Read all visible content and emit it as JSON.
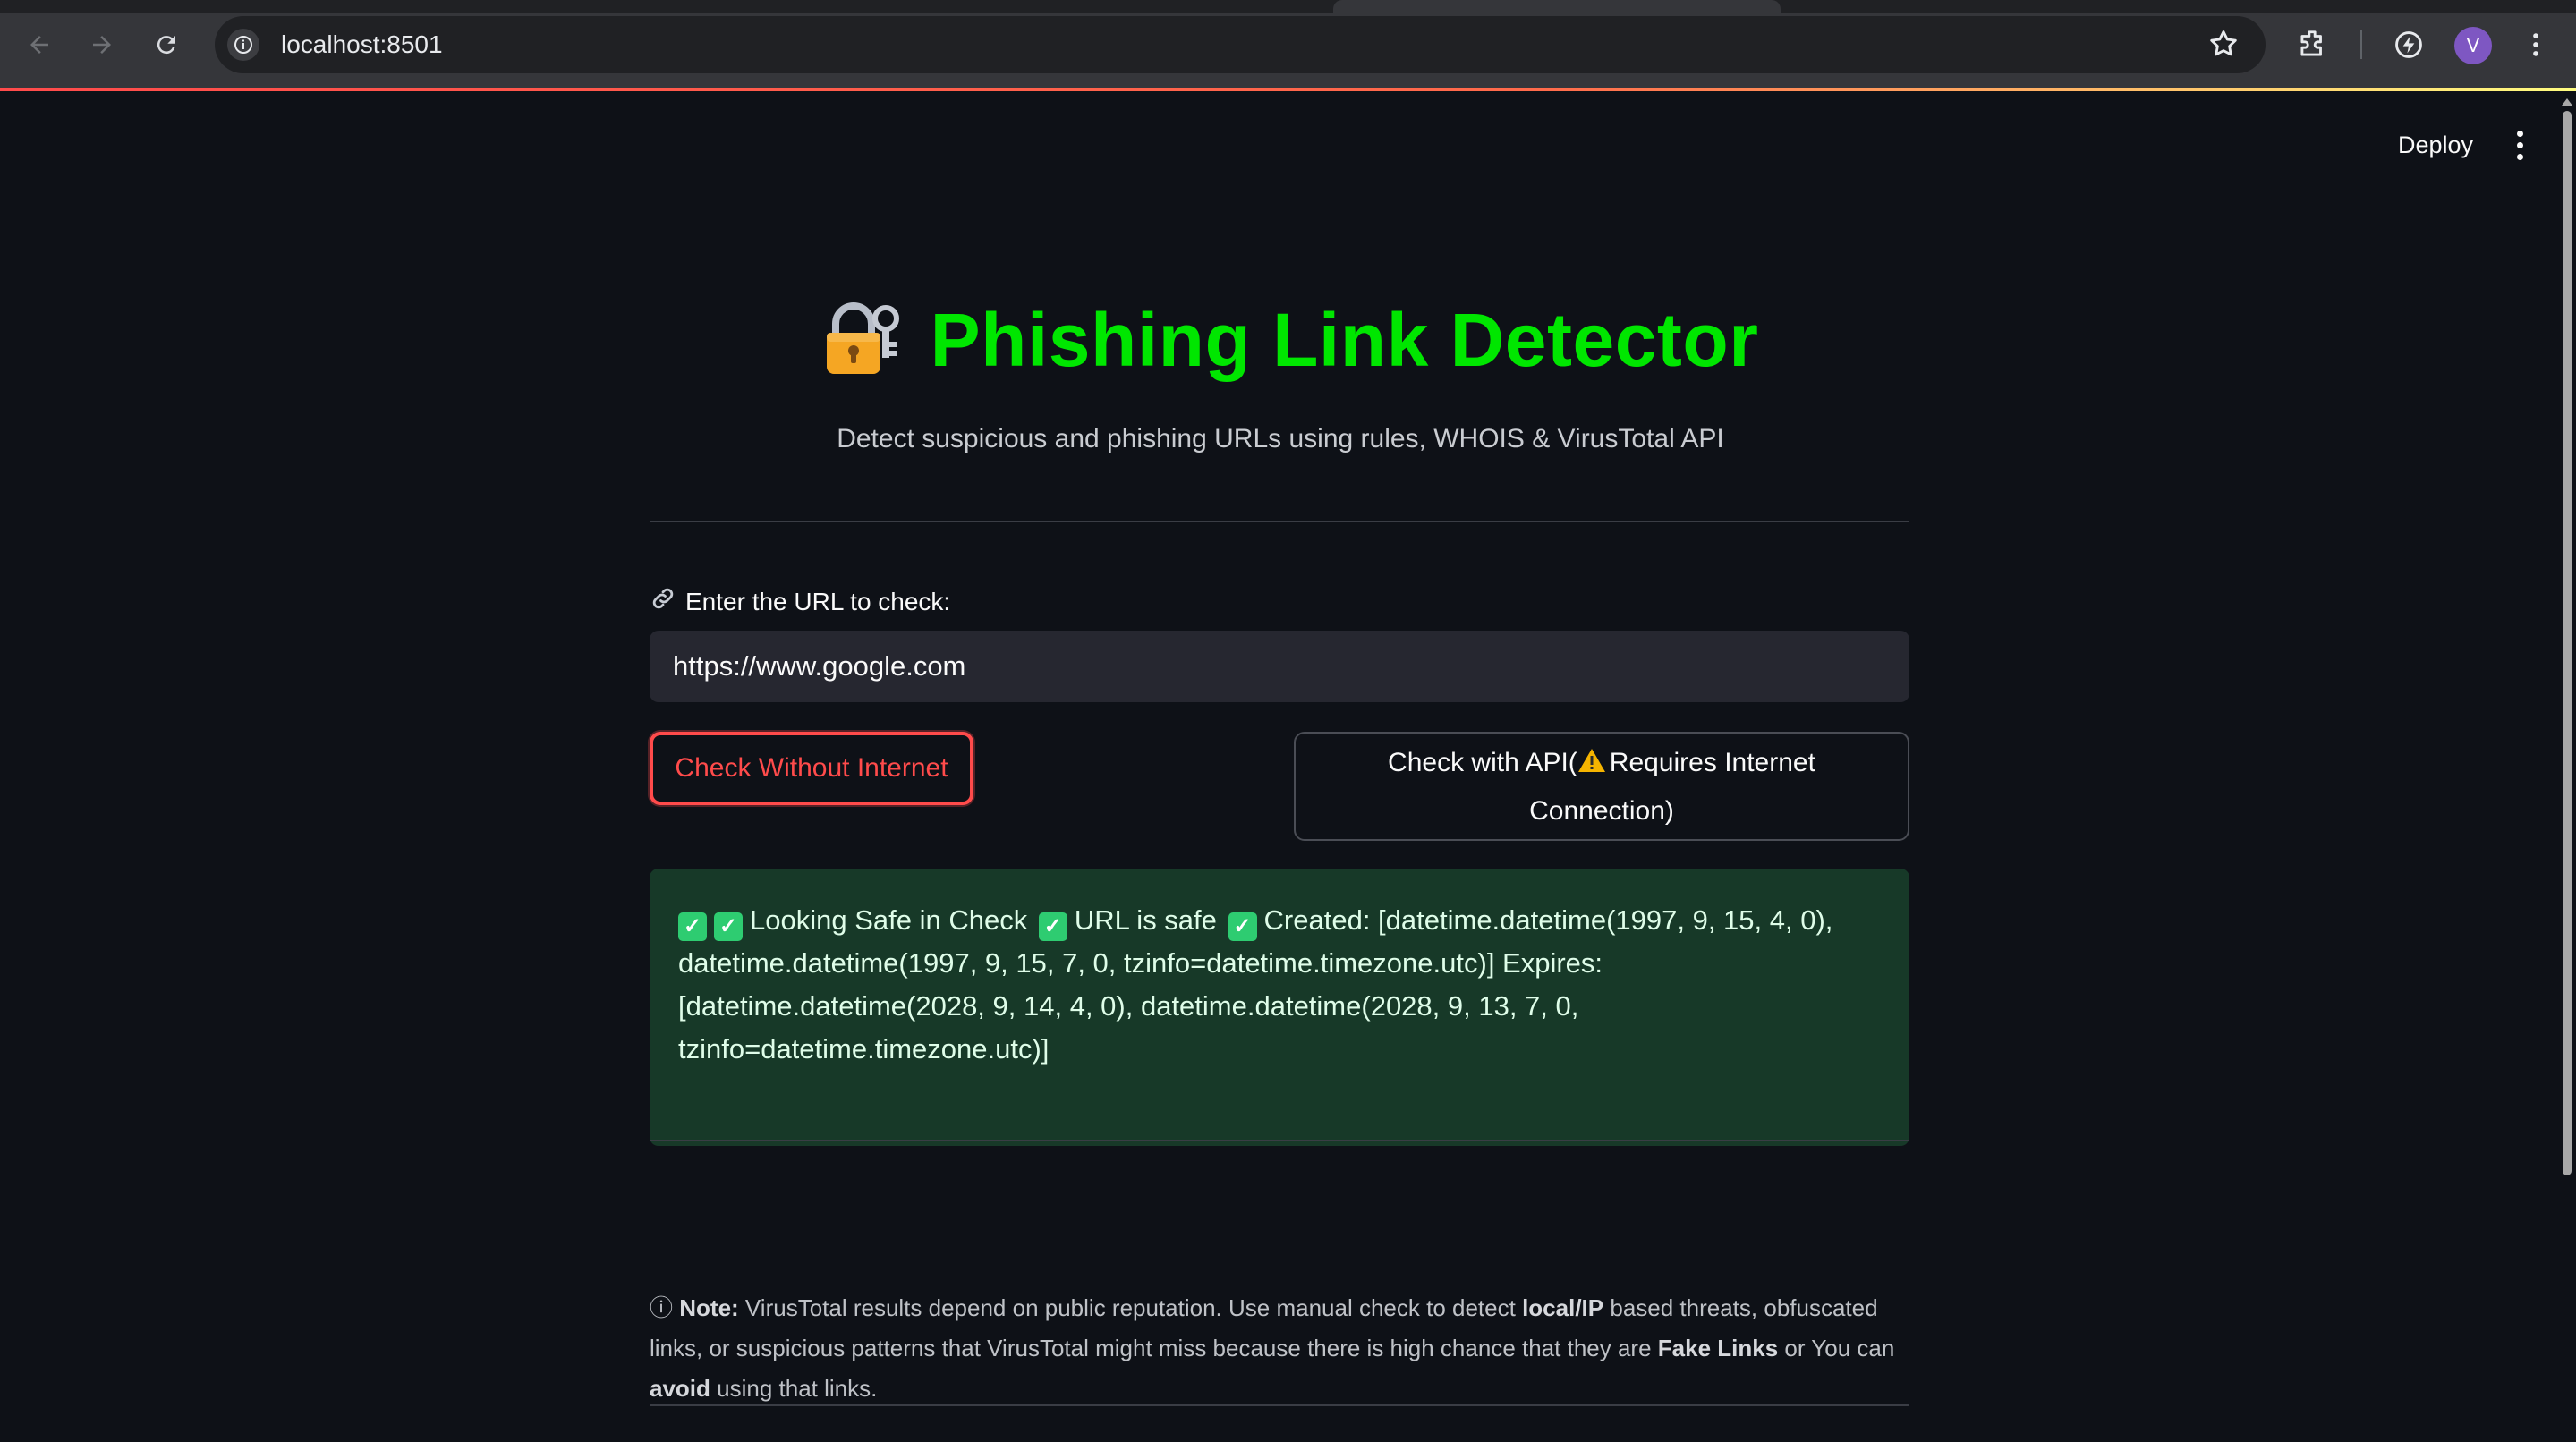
{
  "browser": {
    "url": "localhost:8501",
    "avatar_letter": "V"
  },
  "toolbar": {
    "deploy_label": "Deploy"
  },
  "header": {
    "title": "Phishing Link Detector",
    "subtitle": "Detect suspicious and phishing URLs using rules, WHOIS & VirusTotal API",
    "title_color": "#00e600"
  },
  "form": {
    "label": "Enter the URL to check:",
    "url_value": "https://www.google.com",
    "btn_offline": "Check Without Internet",
    "btn_api_line1": "Check with API(",
    "btn_api_line1b": "Requires Internet",
    "btn_api_line2": "Connection)"
  },
  "result": {
    "part1": "Looking Safe in Check",
    "part2": "URL is safe",
    "part3": "Created: [datetime.datetime(1997, 9, 15, 4, 0), datetime.datetime(1997, 9, 15, 7, 0, tzinfo=datetime.timezone.utc)] Expires: [datetime.datetime(2028, 9, 14, 4, 0), datetime.datetime(2028, 9, 13, 7, 0, tzinfo=datetime.timezone.utc)]"
  },
  "note": {
    "icon": "ⓘ",
    "prefix": "Note:",
    "t1": "VirusTotal results depend on public reputation. Use manual check to detect",
    "b1": "local/IP",
    "t2": "based threats, obfuscated links, or suspicious patterns that VirusTotal might miss because there is high chance that they are",
    "b2": "Fake Links",
    "t3": "or You can",
    "b3": "avoid",
    "t4": "using that links."
  },
  "colors": {
    "accent": "#ff4b4b",
    "success_bg": "#173928",
    "background": "#0e1117"
  }
}
